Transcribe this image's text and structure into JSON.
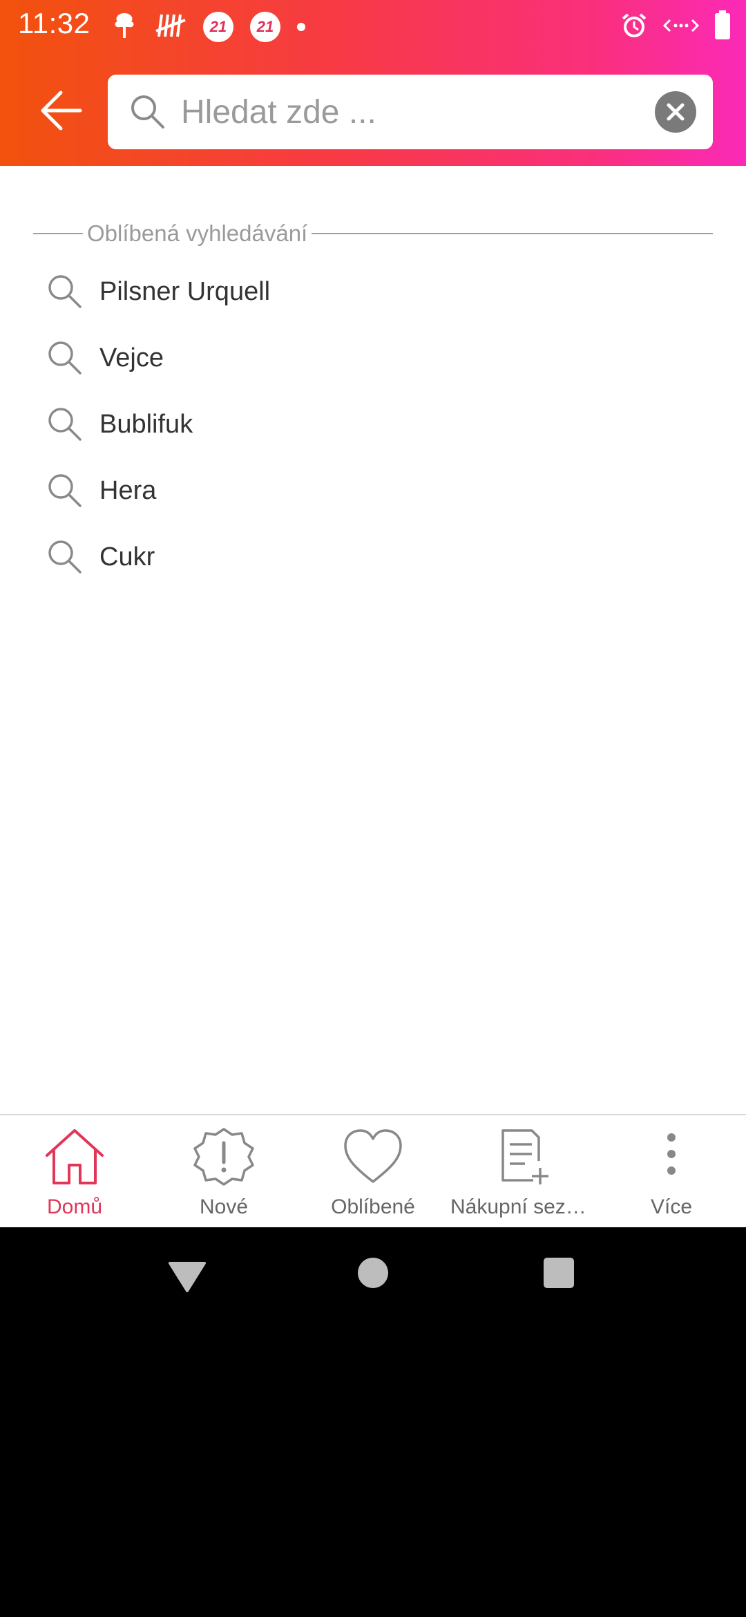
{
  "status_bar": {
    "time": "11:32",
    "badges": [
      "21",
      "21"
    ]
  },
  "search": {
    "placeholder": "Hledat zde ...",
    "value": ""
  },
  "favorites": {
    "title": "Oblíbená vyhledávání",
    "items": [
      "Pilsner Urquell",
      "Vejce",
      "Bublifuk",
      "Hera",
      "Cukr"
    ]
  },
  "bottom_nav": {
    "items": [
      {
        "label": "Domů",
        "icon": "home-icon",
        "active": true
      },
      {
        "label": "Nové",
        "icon": "new-badge-icon",
        "active": false
      },
      {
        "label": "Oblíbené",
        "icon": "heart-icon",
        "active": false
      },
      {
        "label": "Nákupní sezn...",
        "icon": "shopping-list-add-icon",
        "active": false
      },
      {
        "label": "Více",
        "icon": "more-vertical-icon",
        "active": false
      }
    ]
  },
  "colors": {
    "gradient_start": "#f2520d",
    "gradient_end": "#fb2ab8",
    "active": "#e23557",
    "inactive": "#666666"
  }
}
